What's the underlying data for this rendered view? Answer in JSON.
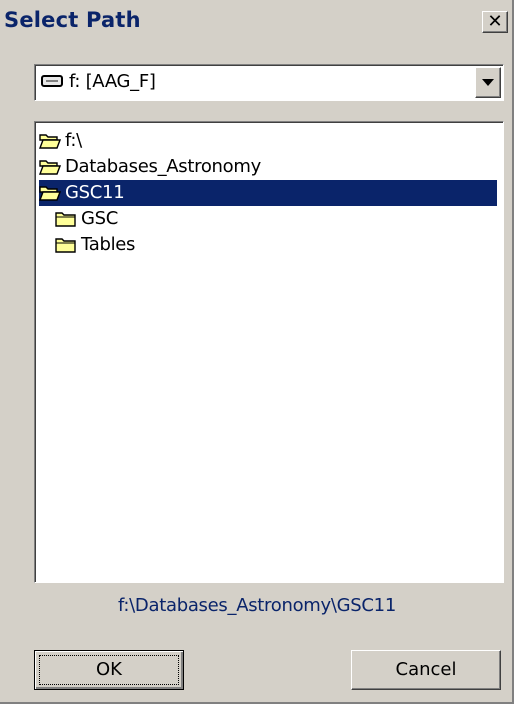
{
  "window": {
    "title": "Select Path",
    "close_glyph": "✕"
  },
  "drive_combo": {
    "icon": "drive-icon",
    "selected": "f: [AAG_F]"
  },
  "tree": {
    "nodes": [
      {
        "label": "f:\\",
        "level": 0,
        "state": "open",
        "selected": false
      },
      {
        "label": "Databases_Astronomy",
        "level": 0,
        "state": "open",
        "selected": false
      },
      {
        "label": "GSC11",
        "level": 0,
        "state": "open",
        "selected": true
      },
      {
        "label": "GSC",
        "level": 1,
        "state": "closed",
        "selected": false
      },
      {
        "label": "Tables",
        "level": 1,
        "state": "closed",
        "selected": false
      }
    ]
  },
  "current_path": "f:\\Databases_Astronomy\\GSC11",
  "buttons": {
    "ok": "OK",
    "cancel": "Cancel"
  },
  "colors": {
    "face": "#d4d0c8",
    "selection": "#0a246a",
    "title_text": "#0a246a",
    "folder": "#ffff99"
  }
}
